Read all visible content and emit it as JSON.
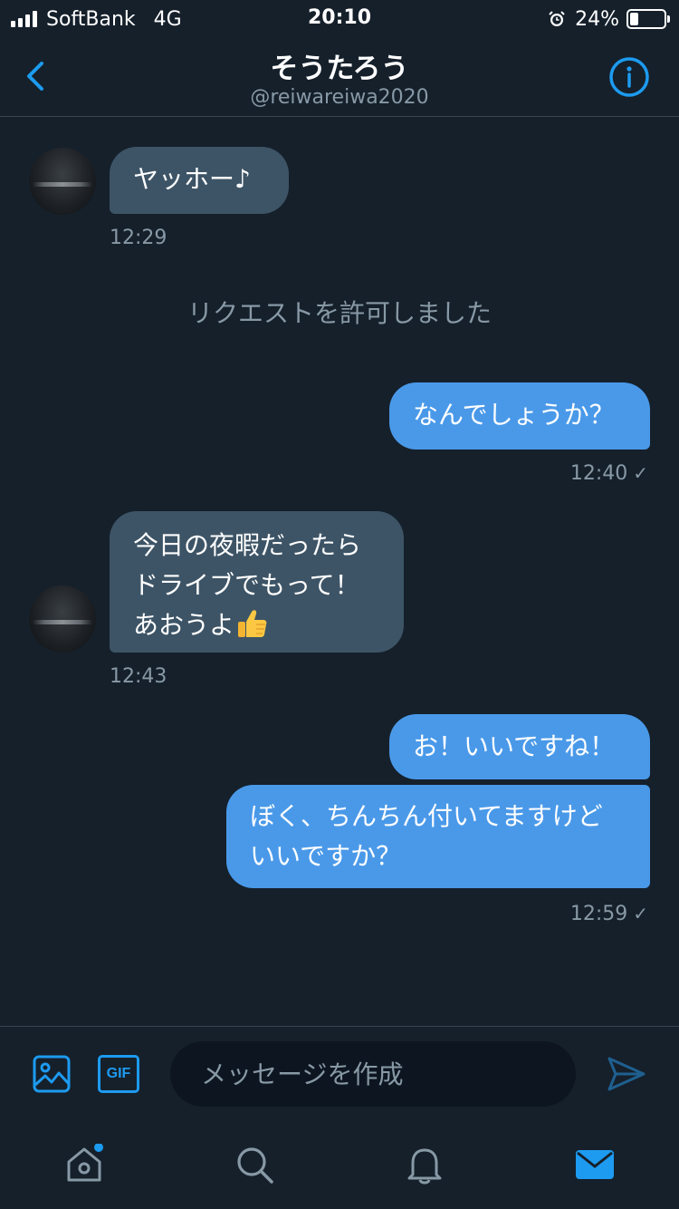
{
  "status_bar": {
    "carrier": "SoftBank",
    "network": "4G",
    "time": "20:10",
    "battery_percent": "24%",
    "battery_level": 0.24,
    "icons": [
      "signal-icon",
      "alarm-icon",
      "battery-icon"
    ]
  },
  "header": {
    "title": "そうたろう",
    "handle": "@reiwareiwa2020",
    "back_icon": "chevron-left-icon",
    "info_icon": "info-icon"
  },
  "conversation": {
    "msg1": {
      "text": "ヤッホー♪",
      "time": "12:29"
    },
    "system_notice": "リクエストを許可しました",
    "msg2": {
      "text": "なんでしょうか？",
      "time": "12:40"
    },
    "msg3": {
      "line1": "今日の夜暇だったら",
      "line2": "ドライブでもって！",
      "line3": "あおうよ",
      "emoji": "thumbs-up-icon",
      "time": "12:43"
    },
    "msg4": {
      "text": "お！いいですね！"
    },
    "msg5": {
      "line1": "ぼく、ちんちん付いてますけど",
      "line2": "いいですか？",
      "time": "12:59"
    },
    "read_mark": "✓"
  },
  "composer": {
    "placeholder": "メッセージを作成",
    "gif_label": "GIF",
    "icons": [
      "image-icon",
      "gif-icon",
      "send-icon"
    ]
  },
  "tabbar": {
    "icons": [
      "home-icon",
      "search-icon",
      "notifications-icon",
      "messages-icon"
    ],
    "active": "messages"
  },
  "colors": {
    "background": "#15202b",
    "accent": "#1d9bf0",
    "sent_bubble": "#4a99e9",
    "received_bubble": "#3d5466",
    "muted_text": "#8899a6",
    "divider": "#38444d"
  }
}
